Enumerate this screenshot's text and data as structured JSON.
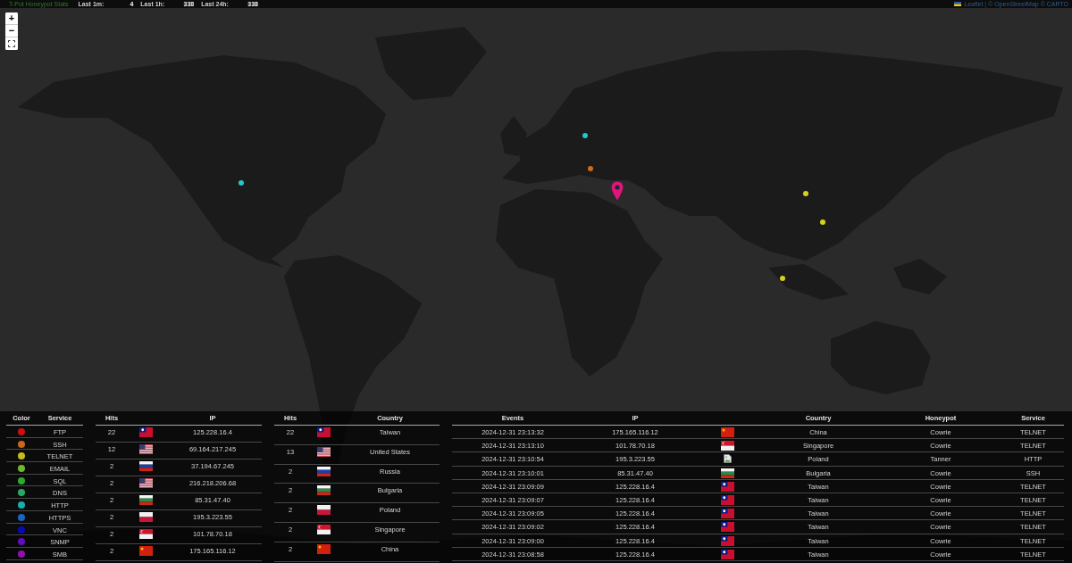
{
  "header": {
    "title": "T-Pot Honeypot Stats",
    "stats": [
      {
        "label": "Last 1m:",
        "value": "4"
      },
      {
        "label": "Last 1h:",
        "value": "338"
      },
      {
        "label": "Last 24h:",
        "value": "338"
      }
    ]
  },
  "attribution": {
    "link": "Leaflet",
    "separator": "|",
    "credits": "© OpenStreetMap © CARTO"
  },
  "map": {
    "zoom_in": "+",
    "zoom_out": "−",
    "markers": [
      {
        "kind": "dot",
        "color": "#22c8c8"
      },
      {
        "kind": "dot",
        "color": "#d0691c"
      },
      {
        "kind": "dot",
        "color": "#22c8c8"
      },
      {
        "kind": "pin",
        "color": "#e0157c"
      },
      {
        "kind": "dot",
        "color": "#d8d020"
      },
      {
        "kind": "dot",
        "color": "#d8d020"
      },
      {
        "kind": "dot",
        "color": "#d8d020"
      }
    ]
  },
  "service_legend": {
    "columns": [
      "Color",
      "Service"
    ],
    "rows": [
      {
        "service": "FTP",
        "color": "#c81212"
      },
      {
        "service": "SSH",
        "color": "#c8661a"
      },
      {
        "service": "TELNET",
        "color": "#c4bb1c"
      },
      {
        "service": "EMAIL",
        "color": "#6bb82a"
      },
      {
        "service": "SQL",
        "color": "#2eaa2e"
      },
      {
        "service": "DNS",
        "color": "#2aa862"
      },
      {
        "service": "HTTP",
        "color": "#1aadad"
      },
      {
        "service": "HTTPS",
        "color": "#1c64c0"
      },
      {
        "service": "VNC",
        "color": "#0a0ab4"
      },
      {
        "service": "SNMP",
        "color": "#6010b8"
      },
      {
        "service": "SMB",
        "color": "#9010b0"
      }
    ]
  },
  "top_ips": {
    "columns": [
      "Hits",
      "IP"
    ],
    "rows": [
      {
        "hits": "22",
        "kind": "tw",
        "ip": "125.228.16.4"
      },
      {
        "hits": "12",
        "kind": "us",
        "ip": "69.164.217.245"
      },
      {
        "hits": "2",
        "kind": "ru",
        "ip": "37.194.67.245"
      },
      {
        "hits": "2",
        "kind": "us",
        "ip": "216.218.206.68"
      },
      {
        "hits": "2",
        "kind": "bg",
        "ip": "85.31.47.40"
      },
      {
        "hits": "2",
        "kind": "pl",
        "ip": "195.3.223.55"
      },
      {
        "hits": "2",
        "kind": "sg",
        "ip": "101.78.70.18"
      },
      {
        "hits": "2",
        "kind": "cn",
        "ip": "175.165.116.12"
      }
    ]
  },
  "top_countries": {
    "columns": [
      "Hits",
      "Country"
    ],
    "rows": [
      {
        "hits": "22",
        "kind": "tw",
        "country": "Taiwan"
      },
      {
        "hits": "13",
        "kind": "us",
        "country": "United States"
      },
      {
        "hits": "2",
        "kind": "ru",
        "country": "Russia"
      },
      {
        "hits": "2",
        "kind": "bg",
        "country": "Bulgaria"
      },
      {
        "hits": "2",
        "kind": "pl",
        "country": "Poland"
      },
      {
        "hits": "2",
        "kind": "sg",
        "country": "Singapore"
      },
      {
        "hits": "2",
        "kind": "cn",
        "country": "China"
      }
    ]
  },
  "events": {
    "columns": [
      "Events",
      "IP",
      "Country",
      "Honeypot",
      "Service"
    ],
    "rows": [
      {
        "time": "2024-12-31 23:13:32",
        "ip": "175.165.116.12",
        "kind": "cn",
        "country": "China",
        "honeypot": "Cowrie",
        "service": "TELNET"
      },
      {
        "time": "2024-12-31 23:13:10",
        "ip": "101.78.70.18",
        "kind": "sg",
        "country": "Singapore",
        "honeypot": "Cowrie",
        "service": "TELNET"
      },
      {
        "time": "2024-12-31 23:10:54",
        "ip": "195.3.223.55",
        "kind": "missing",
        "country": "Poland",
        "honeypot": "Tanner",
        "service": "HTTP"
      },
      {
        "time": "2024-12-31 23:10:01",
        "ip": "85.31.47.40",
        "kind": "bg",
        "country": "Bulgaria",
        "honeypot": "Cowrie",
        "service": "SSH"
      },
      {
        "time": "2024-12-31 23:09:09",
        "ip": "125.228.16.4",
        "kind": "tw",
        "country": "Taiwan",
        "honeypot": "Cowrie",
        "service": "TELNET"
      },
      {
        "time": "2024-12-31 23:09:07",
        "ip": "125.228.16.4",
        "kind": "tw",
        "country": "Taiwan",
        "honeypot": "Cowrie",
        "service": "TELNET"
      },
      {
        "time": "2024-12-31 23:09:05",
        "ip": "125.228.16.4",
        "kind": "tw",
        "country": "Taiwan",
        "honeypot": "Cowrie",
        "service": "TELNET"
      },
      {
        "time": "2024-12-31 23:09:02",
        "ip": "125.228.16.4",
        "kind": "tw",
        "country": "Taiwan",
        "honeypot": "Cowrie",
        "service": "TELNET"
      },
      {
        "time": "2024-12-31 23:09:00",
        "ip": "125.228.16.4",
        "kind": "tw",
        "country": "Taiwan",
        "honeypot": "Cowrie",
        "service": "TELNET"
      },
      {
        "time": "2024-12-31 23:08:58",
        "ip": "125.228.16.4",
        "kind": "tw",
        "country": "Taiwan",
        "honeypot": "Cowrie",
        "service": "TELNET"
      }
    ]
  }
}
